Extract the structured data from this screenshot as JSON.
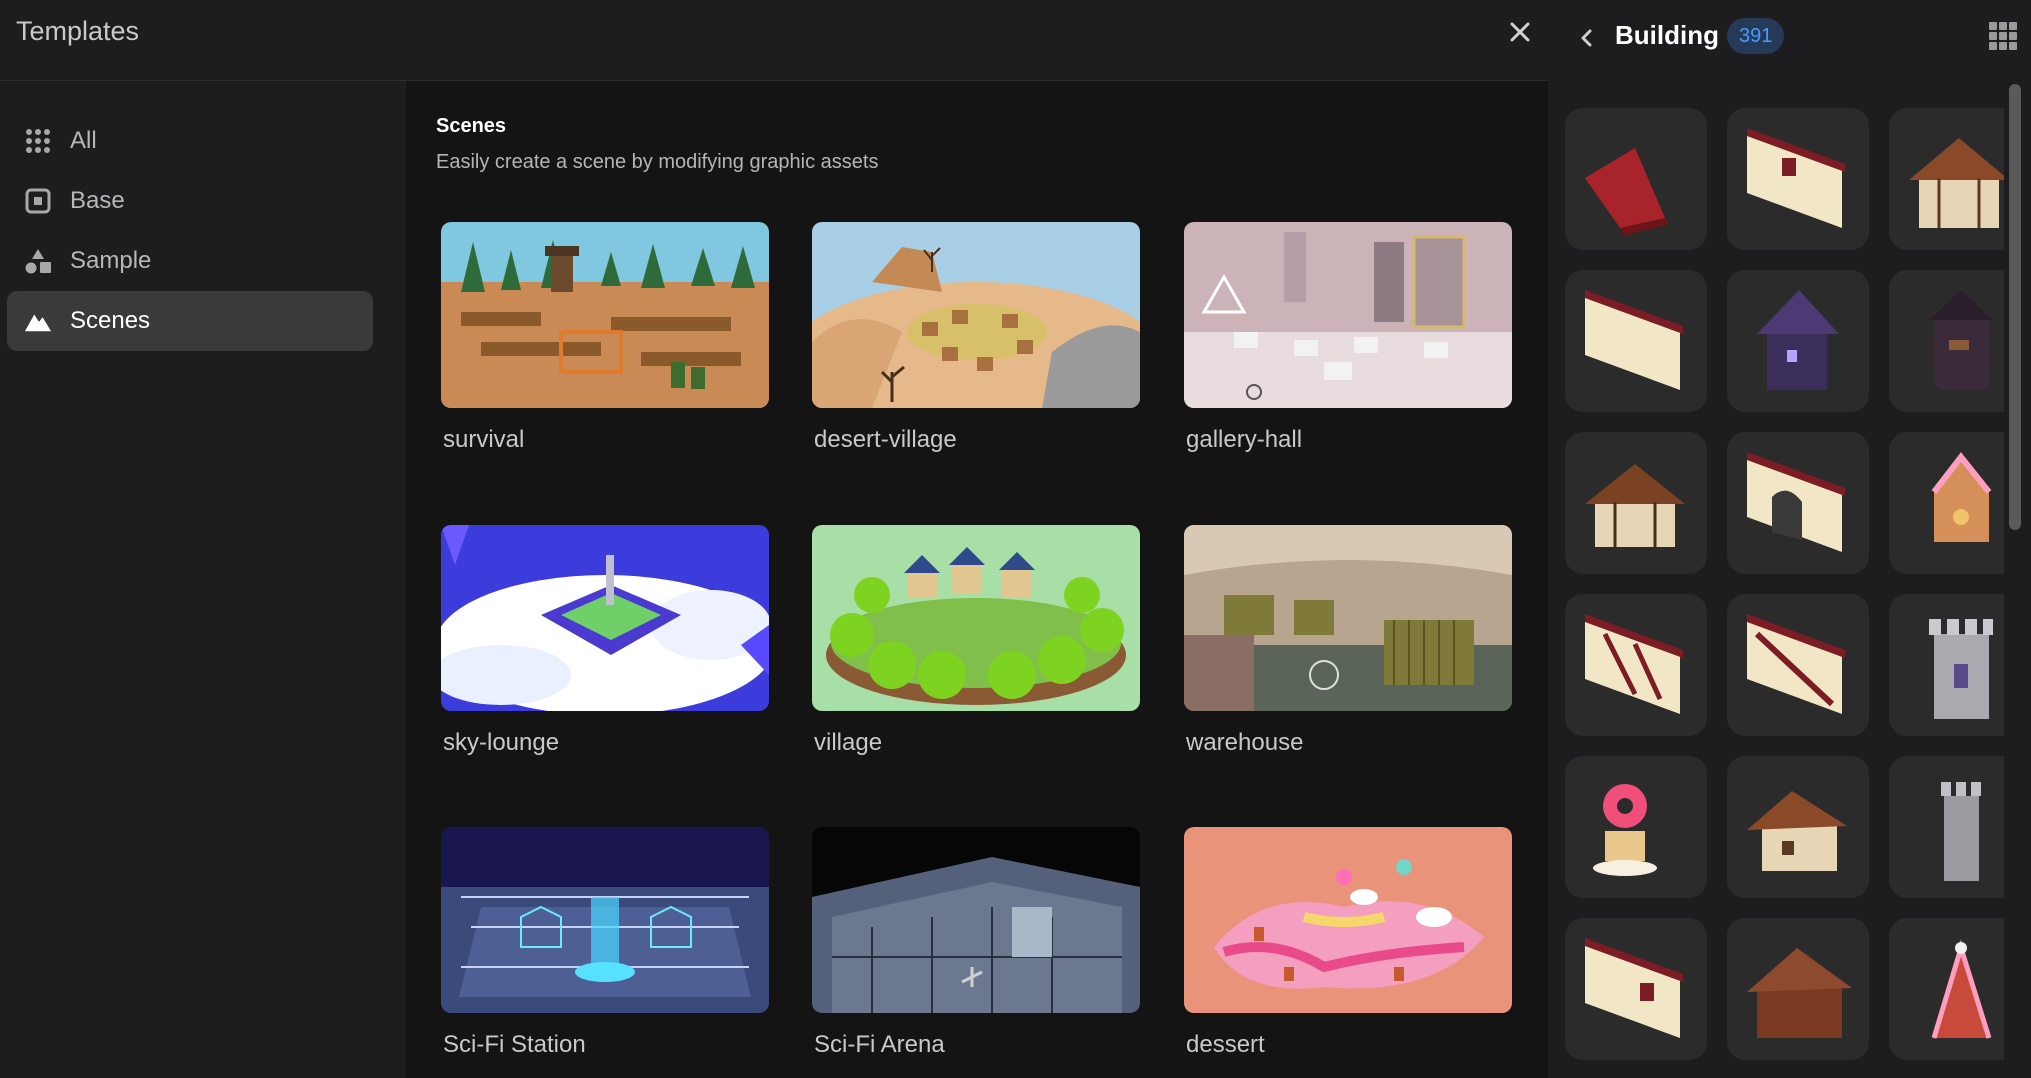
{
  "modal": {
    "title": "Templates"
  },
  "sidebar": {
    "items": [
      {
        "label": "All",
        "icon": "grid-dots-icon",
        "active": false
      },
      {
        "label": "Base",
        "icon": "square-frame-icon",
        "active": false
      },
      {
        "label": "Sample",
        "icon": "shapes-icon",
        "active": false
      },
      {
        "label": "Scenes",
        "icon": "mountain-icon",
        "active": true
      }
    ]
  },
  "section": {
    "title": "Scenes",
    "subtitle": "Easily create a scene by modifying graphic assets"
  },
  "cards": [
    {
      "label": "survival"
    },
    {
      "label": "desert-village"
    },
    {
      "label": "gallery-hall"
    },
    {
      "label": "sky-lounge"
    },
    {
      "label": "village"
    },
    {
      "label": "warehouse"
    },
    {
      "label": "Sci-Fi Station"
    },
    {
      "label": "Sci-Fi Arena"
    },
    {
      "label": "dessert"
    }
  ],
  "right_panel": {
    "title": "Building",
    "count": "391",
    "assets": [
      "red roof",
      "cream wall with window",
      "timber house",
      "cream wall",
      "purple haunted house",
      "dark tower",
      "wooden house",
      "wall with arch",
      "gingerbread house",
      "timber-frame wall",
      "diagonal timber wall",
      "stone castle tower",
      "donut house",
      "brown gabled house",
      "grey stone tower",
      "wall with window",
      "brown wooden cabin",
      "candy roof house"
    ]
  },
  "colors": {
    "background": "#1d1d1f",
    "content_background": "#141414",
    "active_item": "#3a3a3c",
    "badge_text": "#4a9bff",
    "badge_background": "#253a58"
  }
}
